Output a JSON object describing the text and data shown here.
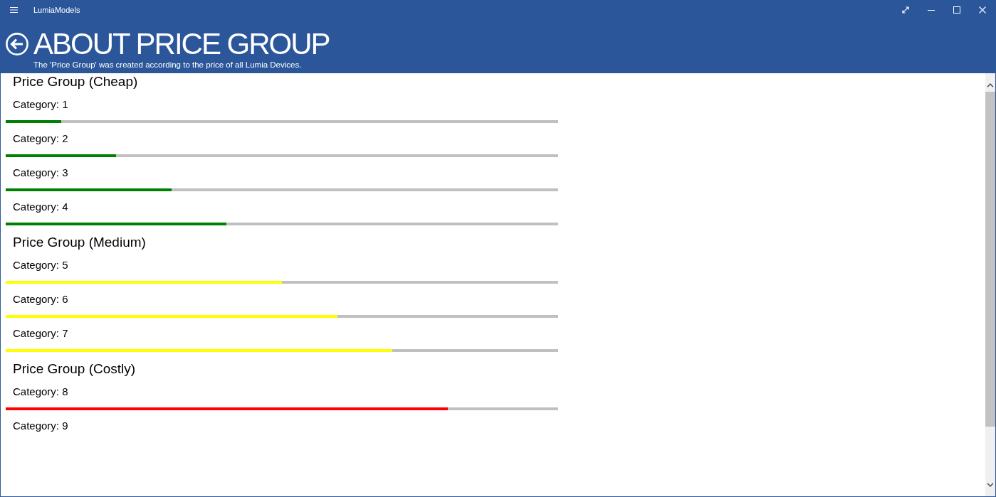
{
  "window": {
    "title": "LumiaModels"
  },
  "page": {
    "title": "ABOUT PRICE GROUP",
    "subtitle": "The 'Price Group' was created according to the price of all Lumia Devices."
  },
  "groups": [
    {
      "title": "Price Group (Cheap)",
      "color": "#008000",
      "items": [
        {
          "label": "Category: 1",
          "level": 0.1
        },
        {
          "label": "Category: 2",
          "level": 0.2
        },
        {
          "label": "Category: 3",
          "level": 0.3
        },
        {
          "label": "Category: 4",
          "level": 0.4
        }
      ]
    },
    {
      "title": "Price Group (Medium)",
      "color": "#ffff00",
      "items": [
        {
          "label": "Category: 5",
          "level": 0.5
        },
        {
          "label": "Category: 6",
          "level": 0.6
        },
        {
          "label": "Category: 7",
          "level": 0.7
        }
      ]
    },
    {
      "title": "Price Group (Costly)",
      "color": "#ff0000",
      "items": [
        {
          "label": "Category: 8",
          "level": 0.8
        },
        {
          "label": "Category: 9"
        }
      ]
    }
  ]
}
